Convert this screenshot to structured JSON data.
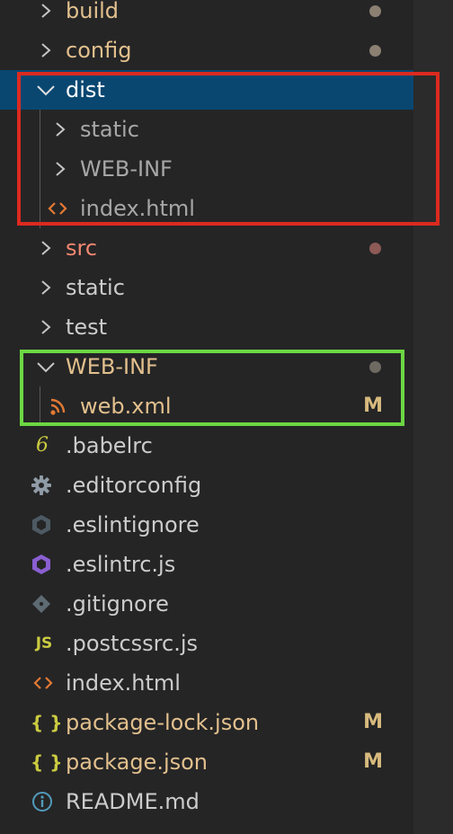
{
  "tree": {
    "build": {
      "label": "build",
      "icon": "chevron-right-icon"
    },
    "config": {
      "label": "config",
      "icon": "chevron-right-icon"
    },
    "dist": {
      "label": "dist",
      "icon": "chevron-down-icon",
      "children": {
        "static": {
          "label": "static",
          "icon": "chevron-right-icon"
        },
        "webinf": {
          "label": "WEB-INF",
          "icon": "chevron-right-icon"
        },
        "index": {
          "label": "index.html",
          "icon": "html-file-icon"
        }
      }
    },
    "src": {
      "label": "src",
      "icon": "chevron-right-icon"
    },
    "static": {
      "label": "static",
      "icon": "chevron-right-icon"
    },
    "test": {
      "label": "test",
      "icon": "chevron-right-icon"
    },
    "webinf": {
      "label": "WEB-INF",
      "icon": "chevron-down-icon",
      "children": {
        "webxml": {
          "label": "web.xml",
          "icon": "rss-xml-file-icon",
          "status": "M"
        }
      }
    },
    "files": {
      "babelrc": {
        "label": ".babelrc",
        "icon": "babel-file-icon",
        "glyph": "6"
      },
      "editorconfig": {
        "label": ".editorconfig",
        "icon": "gear-file-icon"
      },
      "eslintignore": {
        "label": ".eslintignore",
        "icon": "eslint-gray-file-icon"
      },
      "eslintrc": {
        "label": ".eslintrc.js",
        "icon": "eslint-purple-file-icon"
      },
      "gitignore": {
        "label": ".gitignore",
        "icon": "git-file-icon"
      },
      "postcssrc": {
        "label": ".postcssrc.js",
        "icon": "js-file-icon",
        "glyph": "JS"
      },
      "index": {
        "label": "index.html",
        "icon": "html-file-icon"
      },
      "packagelock": {
        "label": "package-lock.json",
        "icon": "json-file-icon",
        "glyph": "{ }",
        "status": "M"
      },
      "package": {
        "label": "package.json",
        "icon": "json-file-icon",
        "glyph": "{ }",
        "status": "M"
      },
      "readme": {
        "label": "README.md",
        "icon": "info-file-icon"
      }
    }
  },
  "colors": {
    "selection": "#094771",
    "highlight_red_box": "#dc2a1f",
    "highlight_green_box": "#6cd742",
    "modified": "#e2c08d",
    "error": "#f48771"
  }
}
